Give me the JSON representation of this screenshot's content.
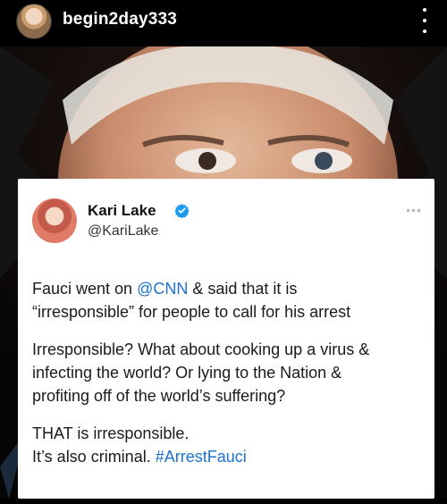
{
  "post": {
    "username": "begin2day333"
  },
  "tweet": {
    "author_name": "Kari Lake",
    "author_handle": "@KariLake",
    "verified_color": "#1D9BF0",
    "link_color": "#1D72D0",
    "para1_start": "Fauci went on ",
    "para1_mention": "@CNN",
    "para1_mid": " & said that it is",
    "para1_line2": "“irresponsible” for people to call for his arrest",
    "para2_line1": "Irresponsible? What about cooking up a virus &",
    "para2_line2": "infecting the world? Or lying to the Nation &",
    "para2_line3": "profiting off of the world’s suffering?",
    "para3_line1": "THAT is irresponsible.",
    "para3_line2_start": "It’s also criminal. ",
    "para3_hashtag": "#ArrestFauci"
  }
}
